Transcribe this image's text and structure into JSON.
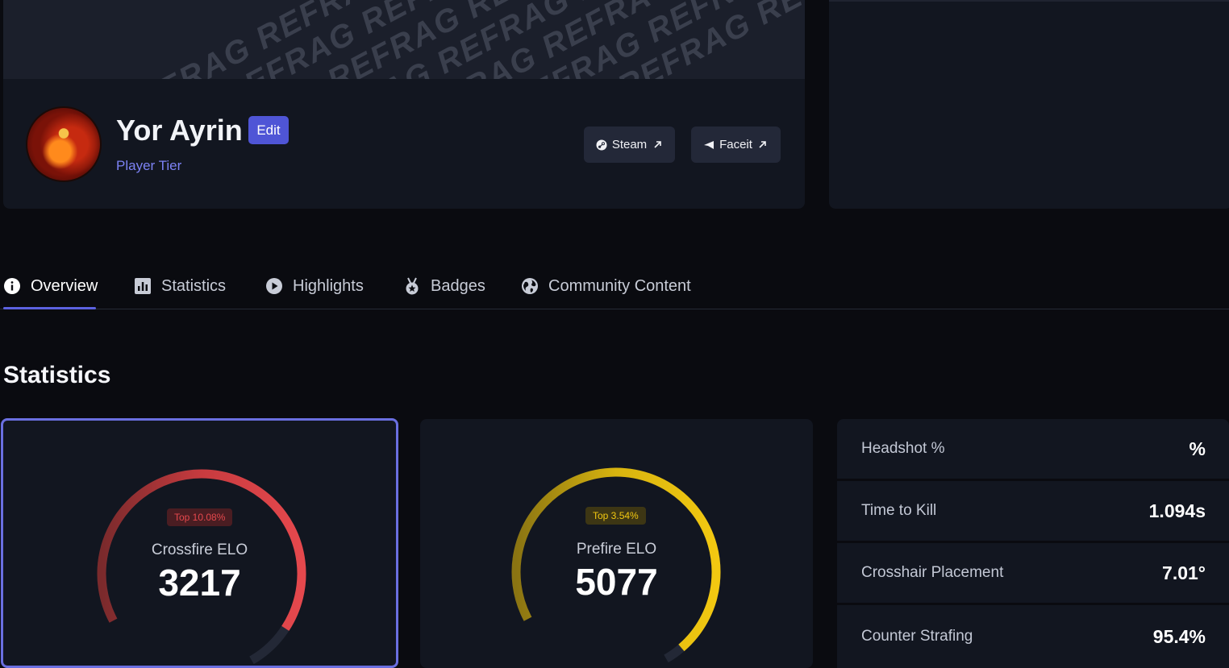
{
  "banner": {
    "pattern_text": "REFRAG"
  },
  "profile": {
    "name": "Yor Ayrin",
    "edit_label": "Edit",
    "tier": "Player Tier",
    "links": [
      {
        "label": "Steam",
        "icon": "steam-icon"
      },
      {
        "label": "Faceit",
        "icon": "faceit-icon"
      }
    ]
  },
  "tabs": [
    {
      "label": "Overview",
      "icon": "info-icon",
      "active": true
    },
    {
      "label": "Statistics",
      "icon": "bar-chart-icon",
      "active": false
    },
    {
      "label": "Highlights",
      "icon": "play-icon",
      "active": false
    },
    {
      "label": "Badges",
      "icon": "medal-icon",
      "active": false
    },
    {
      "label": "Community Content",
      "icon": "globe-icon",
      "active": false
    }
  ],
  "statistics": {
    "title": "Statistics",
    "gauges": [
      {
        "label": "Crossfire ELO",
        "value": "3217",
        "badge": "Top 10.08%",
        "fill": 0.9,
        "color": "#e5484d"
      },
      {
        "label": "Prefire ELO",
        "value": "5077",
        "badge": "Top 3.54%",
        "fill": 0.96,
        "color": "#f2c811"
      }
    ],
    "rows": [
      {
        "label": "Headshot %",
        "value": "%"
      },
      {
        "label": "Time to Kill",
        "value": "1.094s"
      },
      {
        "label": "Crosshair Placement",
        "value": "7.01°"
      },
      {
        "label": "Counter Strafing",
        "value": "95.4%"
      }
    ]
  }
}
